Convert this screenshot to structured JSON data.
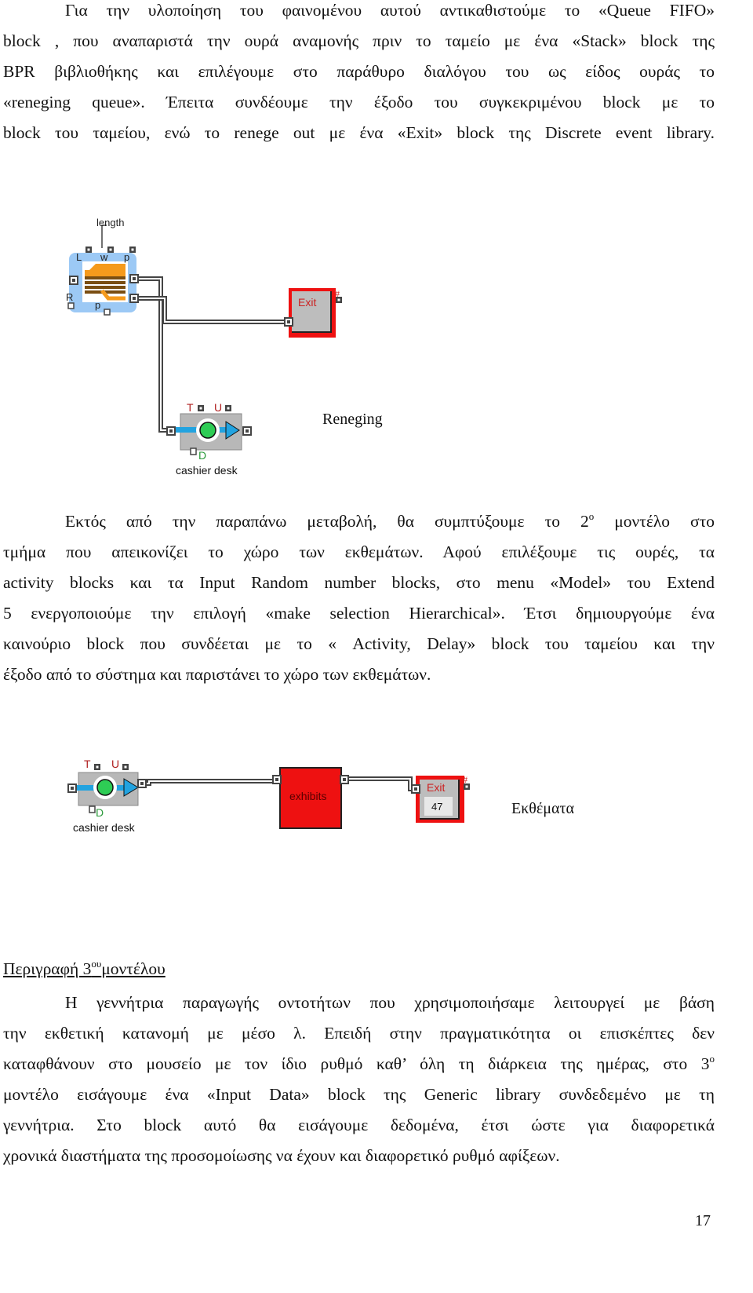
{
  "paragraphs": [
    {
      "lines": [
        {
          "text": "Για την υλοποίηση του φαινομένου αυτού αντικαθιστούμε το «Queue FIFO»"
        },
        {
          "text": "block , που αναπαριστά την ουρά αναμονής πριν το ταμείο με ένα «Stack» block της"
        },
        {
          "text": "BPR βιβλιοθήκης και επιλέγουμε στο παράθυρο διαλόγου του ως είδος ουράς το"
        },
        {
          "text": "«reneging queue». Έπειτα συνδέουμε την έξοδο του συγκεκριμένου block με το"
        },
        {
          "text": "block του ταμείου, ενώ το renege out με ένα «Exit» block της  Discrete event library."
        }
      ]
    },
    {
      "lines": [
        {
          "text": "Εκτός από την παραπάνω μεταβολή, θα συμπτύξουμε το 2",
          "sup": "ο",
          "rest": " μοντέλο στο"
        },
        {
          "text": "τμήμα που απεικονίζει το χώρο των εκθεμάτων. Αφού επιλέξουμε τις ουρές, τα"
        },
        {
          "text": "activity blocks και τα Input Random number blocks, στο  menu «Model» του Extend"
        },
        {
          "text": "5 ενεργοποιούμε την επιλογή «make selection Hierarchical». Έτσι δημιουργούμε ένα"
        },
        {
          "text": "καινούριο  block που συνδέεται με το « Activity, Delay» block του ταμείου και την"
        },
        {
          "text": "έξοδο από το σύστημα και παριστάνει το χώρο των εκθεμάτων."
        }
      ]
    },
    {
      "lines": [
        {
          "text": "Η γεννήτρια παραγωγής οντοτήτων που χρησιμοποιήσαμε λειτουργεί με βάση"
        },
        {
          "text": "την εκθετική κατανομή με μέσο λ. Επειδή στην πραγματικότητα οι επισκέπτες δεν"
        },
        {
          "text": "καταφθάνουν στο μουσείο με τον ίδιο ρυθμό καθ’ όλη τη διάρκεια της ημέρας, στο 3",
          "sup": "ο",
          "rest": ""
        },
        {
          "text": "μοντέλο εισάγουμε ένα «Input Data»  block της  Generic library συνδεδεμένο με τη"
        },
        {
          "text": "γεννήτρια. Στο  block αυτό θα εισάγουμε δεδομένα, έτσι ώστε για διαφορετικά"
        },
        {
          "text": "χρονικά διαστήματα της προσομοίωσης να έχουν και διαφορετικό ρυθμό αφίξεων."
        }
      ]
    }
  ],
  "heading": {
    "text": "Περιγραφή 3",
    "sup": "ου",
    "rest": "μοντέλου"
  },
  "diagram1": {
    "stack_label_length": "length",
    "port_L": "L",
    "port_w": "w",
    "port_p_top": "p",
    "port_R": "R",
    "port_p_bottom": "p",
    "exit_label": "Exit",
    "exit_hash": "#",
    "activity_T": "T",
    "activity_U": "U",
    "activity_D": "D",
    "activity_name": "cashier desk",
    "annotation": "Reneging"
  },
  "diagram2": {
    "activity_T": "T",
    "activity_U": "U",
    "activity_D": "D",
    "activity_name": "cashier desk",
    "hblock_label": "exhibits",
    "exit_label": "Exit",
    "exit_count": "47",
    "exit_hash": "#",
    "annotation": "Εκθέματα"
  },
  "colors": {
    "block_red": "#ee1111",
    "exit_text": "#cc2222",
    "stack_bg": "#9cc9f5",
    "stack_orange": "#f59a1c",
    "arrow_blue": "#22a3e0",
    "green": "#2ecc55",
    "grey": "#b8b8b8"
  },
  "page_number": "17"
}
